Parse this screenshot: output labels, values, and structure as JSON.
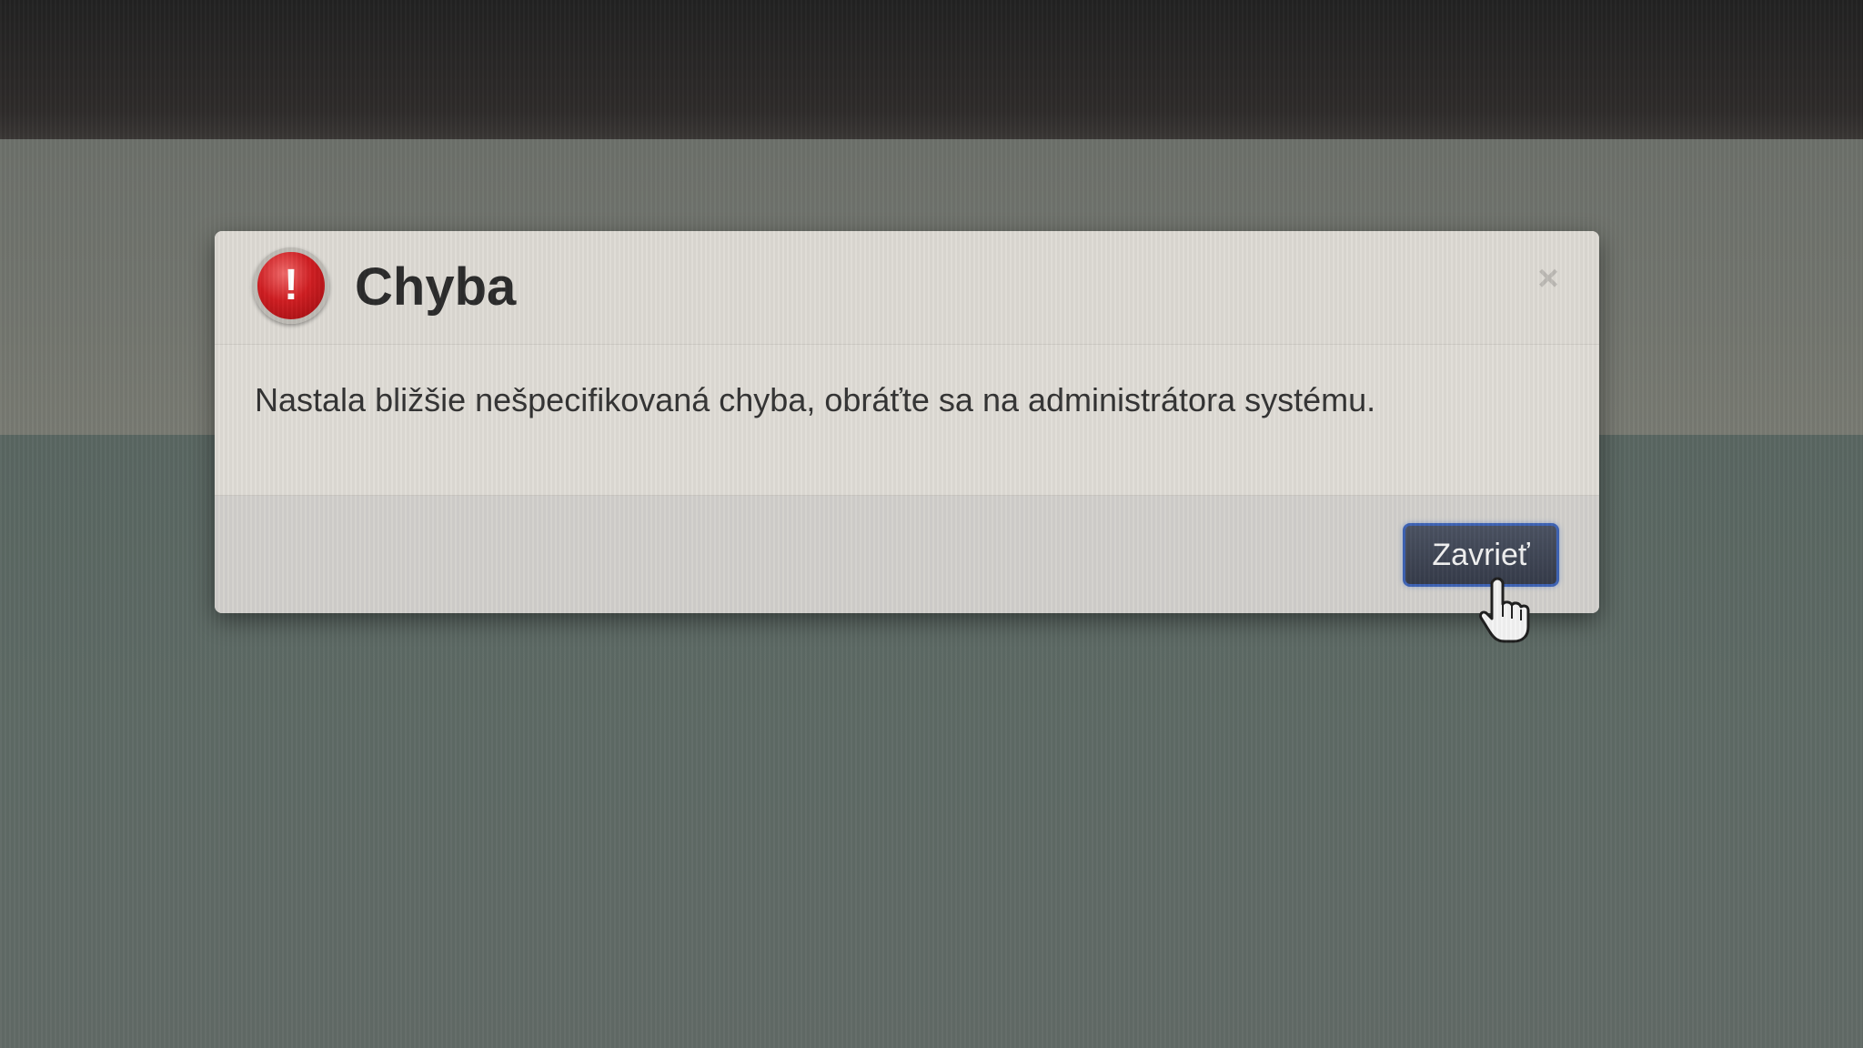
{
  "dialog": {
    "title": "Chyba",
    "message": "Nastala bližšie nešpecifikovaná chyba, obráťte sa na administrátora systému.",
    "icon": "error-exclamation-icon",
    "icon_glyph": "!",
    "icon_color": "#d01e22",
    "close_glyph": "×",
    "close_button_label": "Zavrieť",
    "button_color": "#363c4a",
    "button_border_color": "#3e63b5"
  },
  "cursor": {
    "icon": "hand-pointer-icon"
  }
}
